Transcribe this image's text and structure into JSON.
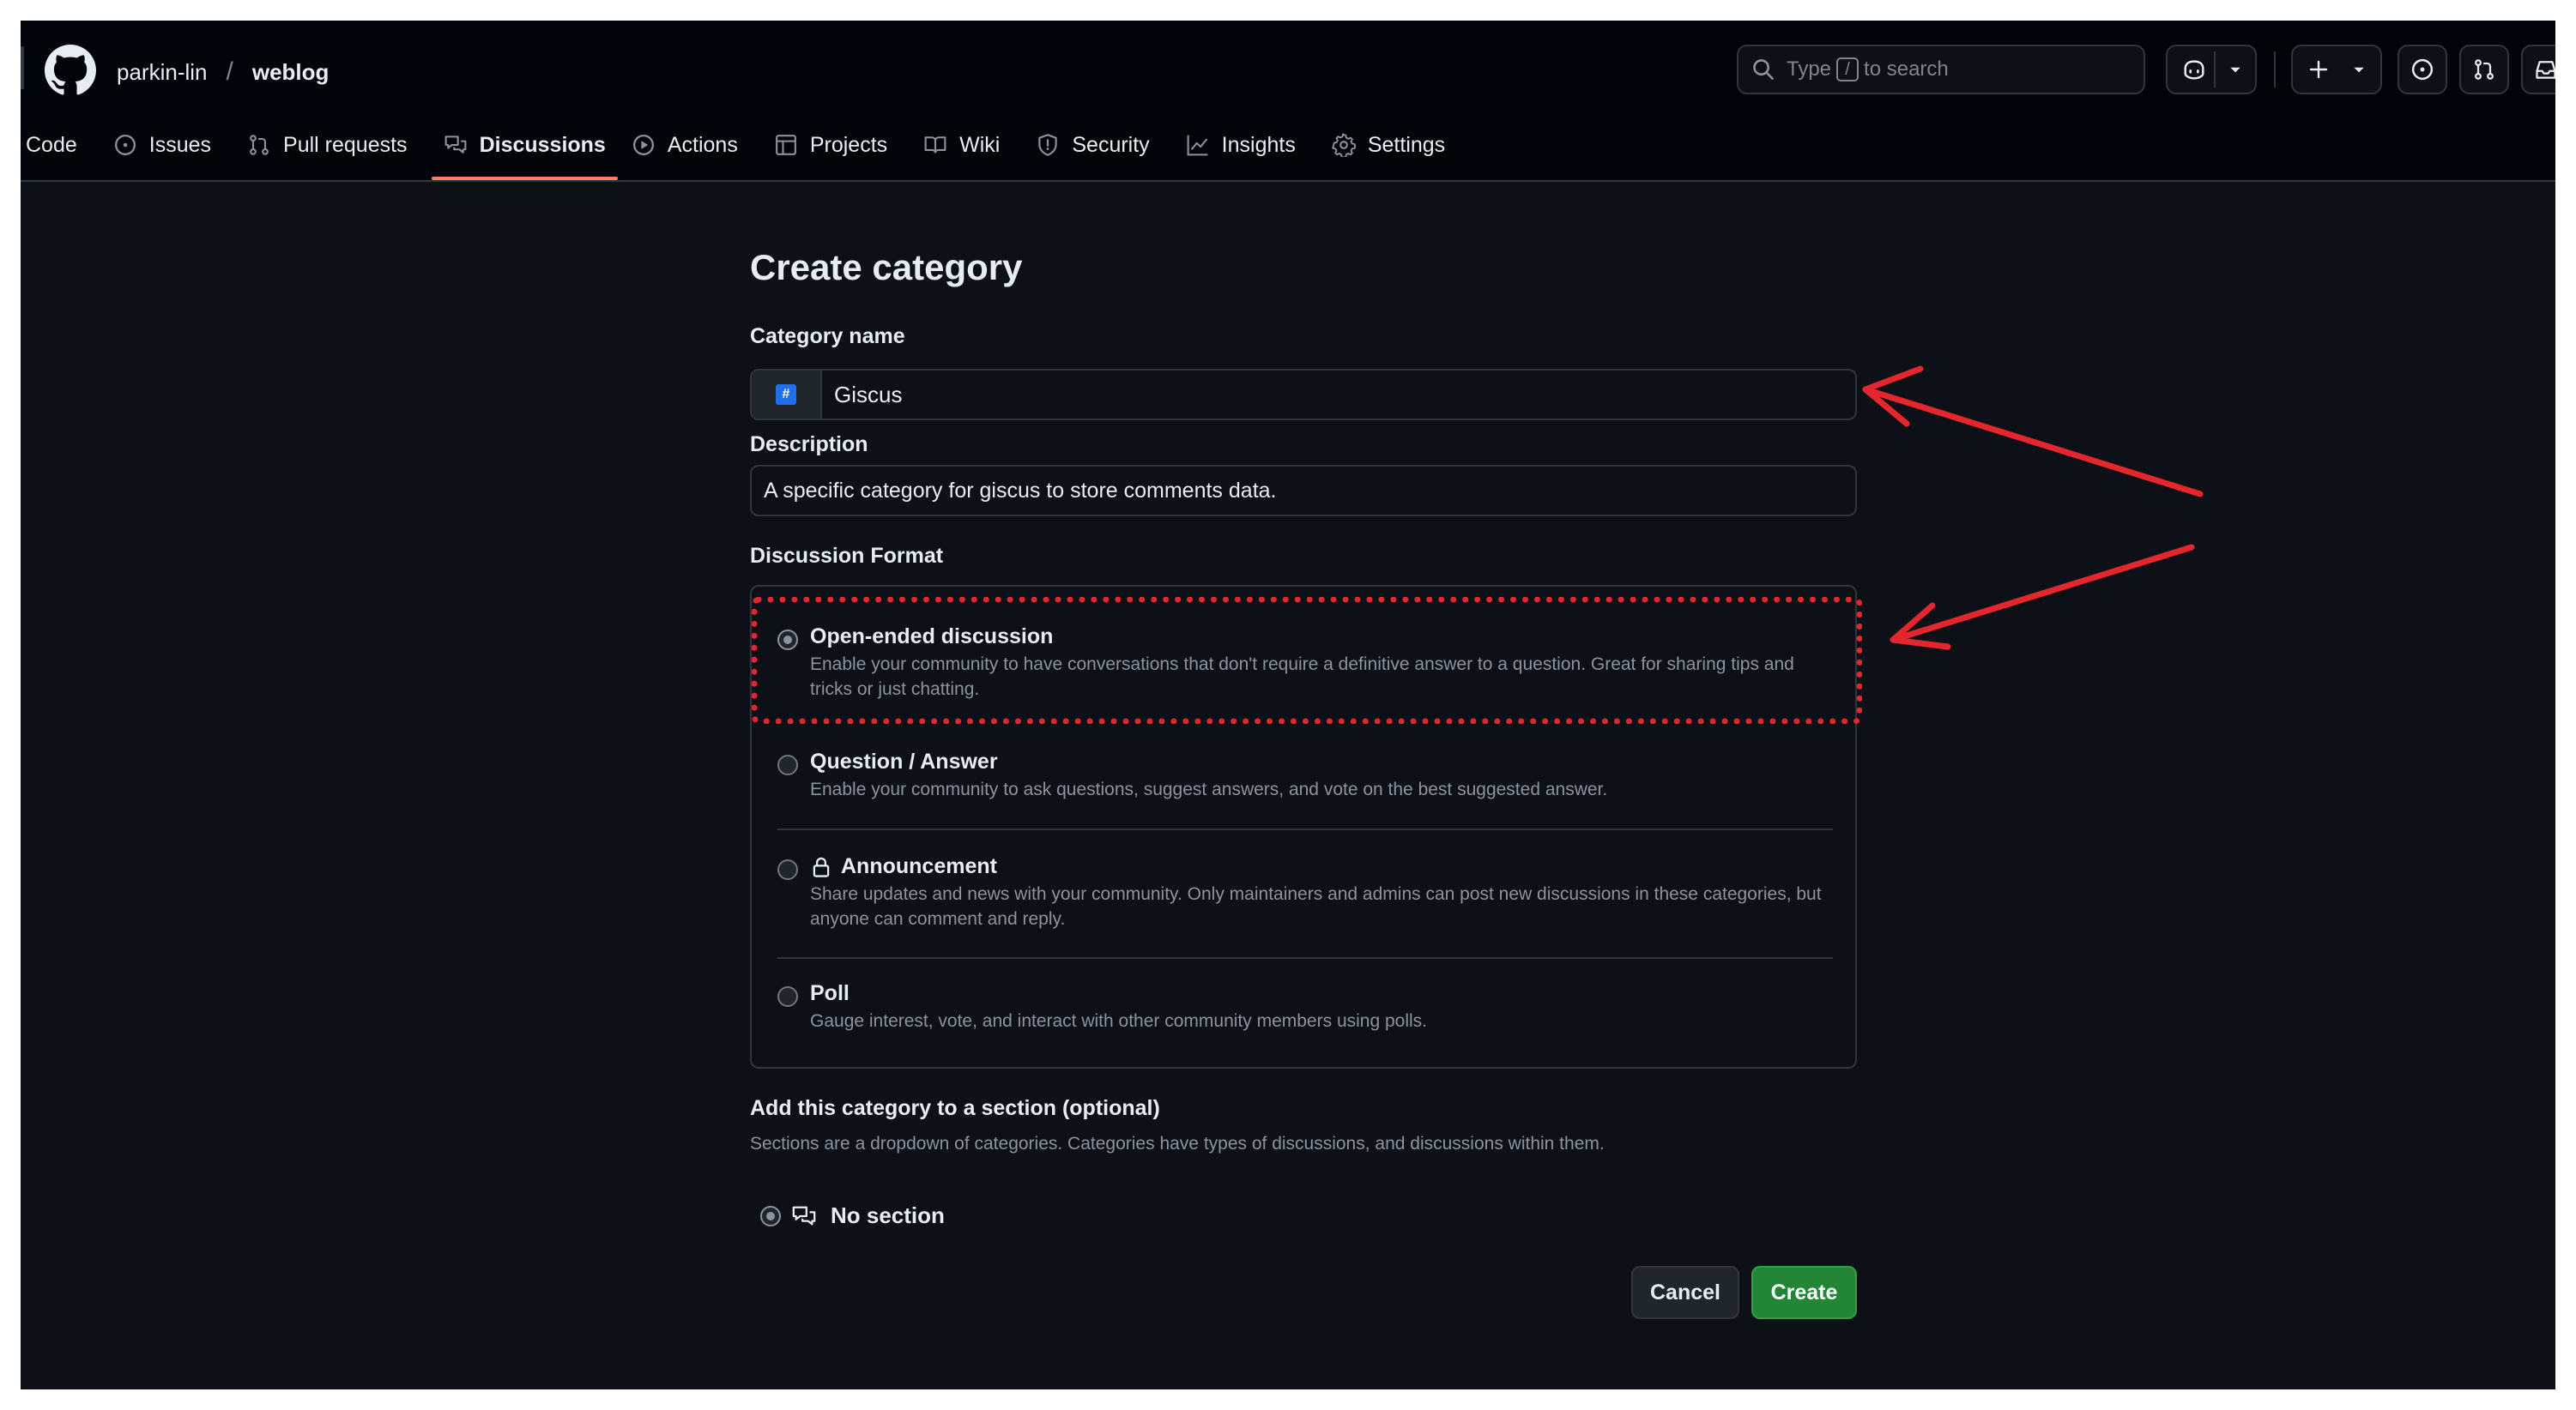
{
  "repo": {
    "owner": "parkin-lin",
    "separator": "/",
    "name": "weblog"
  },
  "search": {
    "prefix": "Type",
    "key": "/",
    "suffix": "to search"
  },
  "icons": {
    "logo": "github-logo-icon",
    "search": "search-icon",
    "copilot": "copilot-icon",
    "plus": "plus-icon",
    "issues": "issue-opened-icon",
    "pulls": "git-pull-request-icon",
    "inbox": "inbox-icon"
  },
  "nav": {
    "code": "Code",
    "issues": "Issues",
    "pulls": "Pull requests",
    "discussions": "Discussions",
    "actions": "Actions",
    "projects": "Projects",
    "wiki": "Wiki",
    "security": "Security",
    "insights": "Insights",
    "settings": "Settings"
  },
  "form": {
    "title": "Create category",
    "name_label": "Category name",
    "name_value": "Giscus",
    "emoji": "#",
    "desc_label": "Description",
    "desc_value": "A specific category for giscus to store comments data.",
    "format_label": "Discussion Format",
    "formats": [
      {
        "title": "Open-ended discussion",
        "desc": "Enable your community to have conversations that don't require a definitive answer to a question. Great for sharing tips and tricks or just chatting.",
        "checked": true
      },
      {
        "title": "Question / Answer",
        "desc": "Enable your community to ask questions, suggest answers, and vote on the best suggested answer."
      },
      {
        "title": "Announcement",
        "desc": "Share updates and news with your community. Only maintainers and admins can post new discussions in these categories, but anyone can comment and reply."
      },
      {
        "title": "Poll",
        "desc": "Gauge interest, vote, and interact with other community members using polls."
      }
    ],
    "section_label": "Add this category to a section (optional)",
    "section_desc": "Sections are a dropdown of categories. Categories have types of discussions, and discussions within them.",
    "no_section": "No section",
    "cancel": "Cancel",
    "create": "Create"
  },
  "colors": {
    "background": "#0d1117",
    "header": "#010409",
    "border": "#30363d",
    "active_tab": "#f78166",
    "create_button": "#238636",
    "annotation": "#e5262c"
  }
}
